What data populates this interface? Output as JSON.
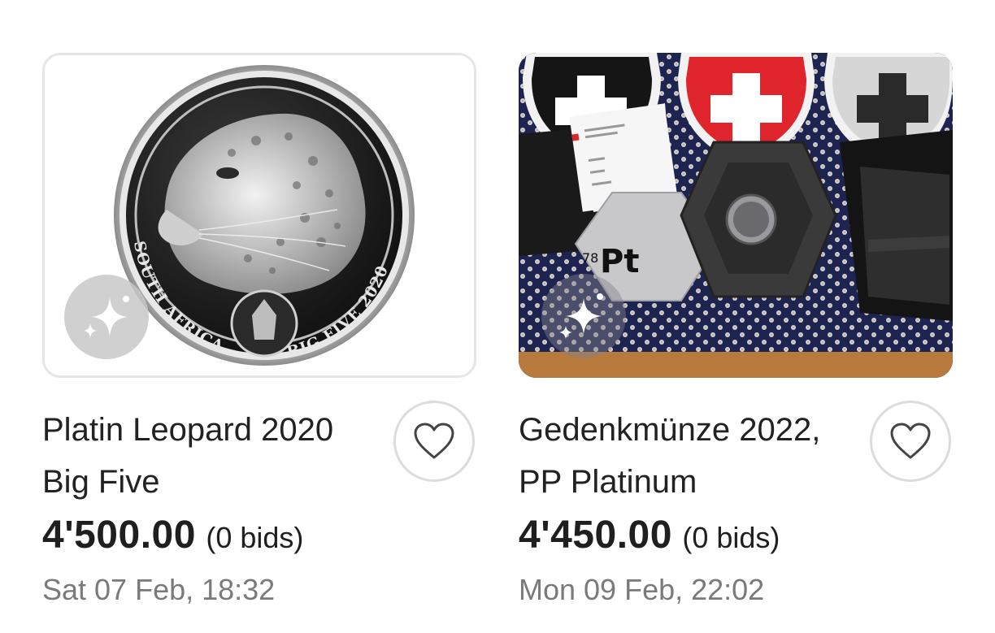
{
  "listings": [
    {
      "title": "Platin Leopard 2020 Big Five",
      "price": "4'500.00",
      "bids": "(0 bids)",
      "end_time": "Sat 07 Feb, 18:32",
      "image_alt": "Leopard platinum coin",
      "coin_text_left": "SOUTH AFRICA",
      "coin_text_right": "BIG FIVE 2020",
      "badge_icon": "sparkle-icon",
      "favorite_icon": "heart-icon"
    },
    {
      "title": "Gedenkmünze 2022, PP  Platinum",
      "price": "4'450.00",
      "bids": "(0 bids)",
      "end_time": "Mon 09 Feb, 22:02",
      "image_alt": "Swiss platinum commemorative coin in hexagonal case",
      "element_number": "78",
      "element_symbol": "Pt",
      "badge_icon": "sparkle-icon",
      "favorite_icon": "heart-icon"
    }
  ],
  "colors": {
    "swiss_red": "#e0242b",
    "text_primary": "#222222",
    "text_secondary": "#7a7a7a"
  }
}
